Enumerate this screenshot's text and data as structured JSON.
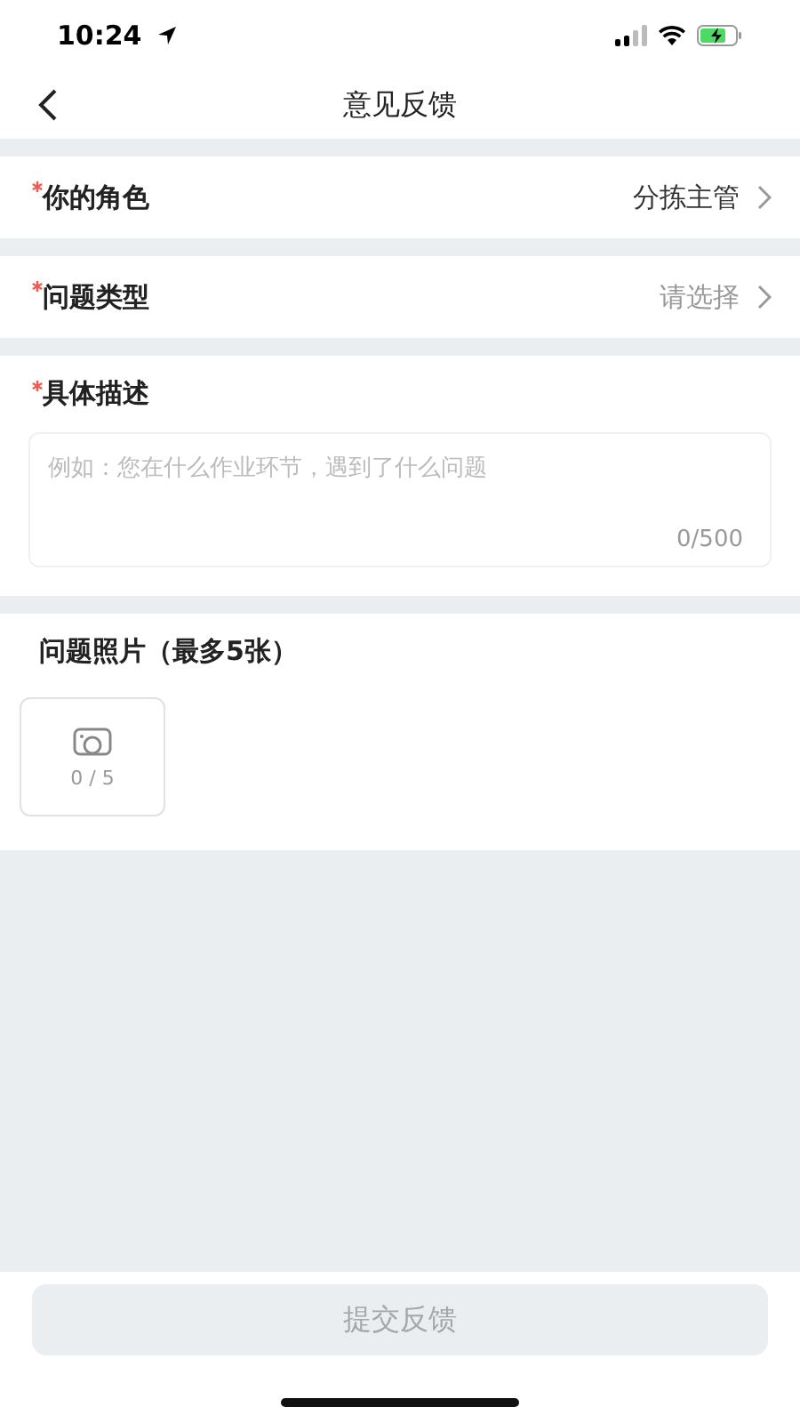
{
  "status_bar": {
    "time": "10:24",
    "battery_charging": true
  },
  "nav": {
    "title": "意见反馈"
  },
  "select_rows": [
    {
      "label": "你的角色",
      "required": true,
      "value": "分拣主管"
    },
    {
      "label": "问题类型",
      "required": true,
      "placeholder": "请选择"
    }
  ],
  "description": {
    "label": "具体描述",
    "required": true,
    "placeholder": "例如：您在什么作业环节，遇到了什么问题",
    "counter": "0/500"
  },
  "photos": {
    "label": "问题照片（最多5张）",
    "upload_count": "0 / 5"
  },
  "submit": {
    "label": "提交反馈",
    "disabled": true
  }
}
